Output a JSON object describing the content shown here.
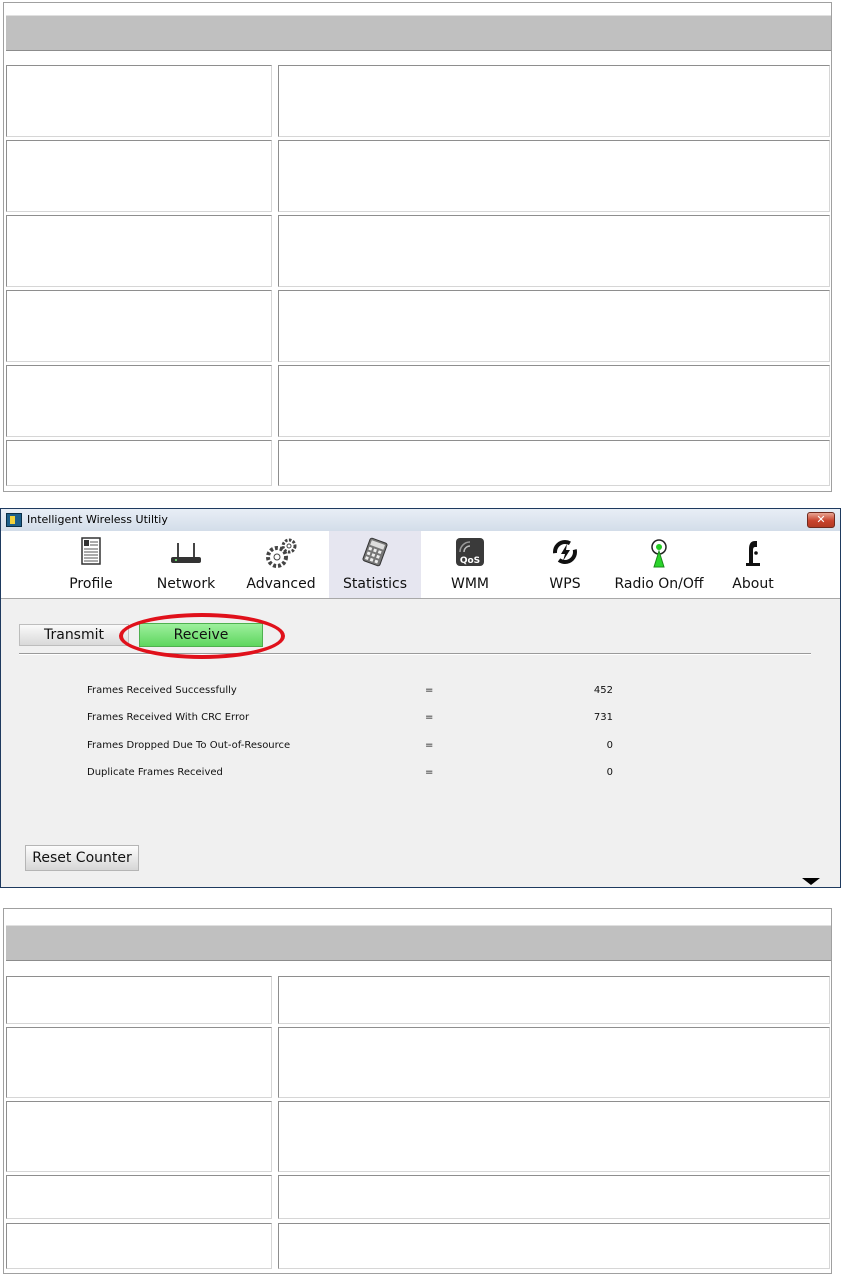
{
  "window": {
    "title": "Intelligent Wireless Utiltiy",
    "close_label": "✕"
  },
  "toolbar": {
    "items": [
      {
        "label": "Profile",
        "icon": "profile-icon"
      },
      {
        "label": "Network",
        "icon": "network-icon"
      },
      {
        "label": "Advanced",
        "icon": "advanced-icon"
      },
      {
        "label": "Statistics",
        "icon": "statistics-icon",
        "active": true
      },
      {
        "label": "WMM",
        "icon": "wmm-qos-icon",
        "icon_text": "QoS"
      },
      {
        "label": "WPS",
        "icon": "wps-icon"
      },
      {
        "label": "Radio On/Off",
        "icon": "radio-icon"
      },
      {
        "label": "About",
        "icon": "about-icon"
      }
    ]
  },
  "tabs": {
    "transmit": "Transmit",
    "receive": "Receive",
    "selected": "Receive"
  },
  "stats": [
    {
      "label": "Frames Received Successfully",
      "eq": "=",
      "value": "452"
    },
    {
      "label": "Frames Received With CRC Error",
      "eq": "=",
      "value": "731"
    },
    {
      "label": "Frames Dropped Due To Out-of-Resource",
      "eq": "=",
      "value": "0"
    },
    {
      "label": "Duplicate Frames Received",
      "eq": "=",
      "value": "0"
    }
  ],
  "reset_label": "Reset Counter",
  "colors": {
    "selected_tab": "#6ee06e",
    "highlight_ring": "#e0111b",
    "table_header": "#c0c0c0"
  }
}
